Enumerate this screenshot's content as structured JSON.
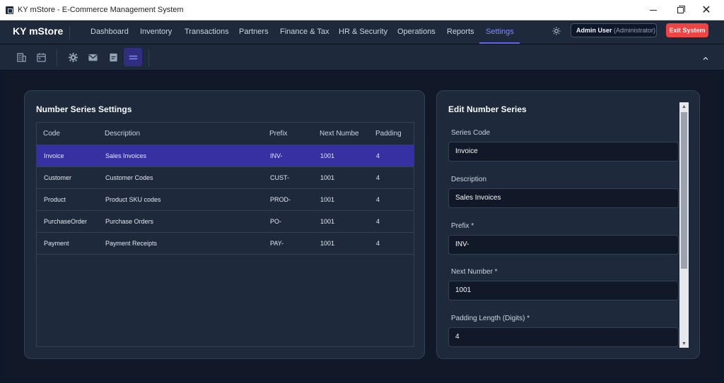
{
  "window": {
    "title": "KY mStore - E-Commerce Management System",
    "minimize_glyph": "",
    "maximize_glyph": "",
    "close_glyph": "✕"
  },
  "appbar": {
    "brand": "KY mStore",
    "nav": [
      {
        "label": "Dashboard"
      },
      {
        "label": "Inventory"
      },
      {
        "label": "Transactions"
      },
      {
        "label": "Partners"
      },
      {
        "label": "Finance & Tax"
      },
      {
        "label": "HR & Security"
      },
      {
        "label": "Operations"
      },
      {
        "label": "Reports"
      },
      {
        "label": "Settings",
        "active": true
      }
    ],
    "user_name": "Admin User",
    "user_role": "(Administrator)",
    "exit_label": "Exit System",
    "accent_color": "#6366f1",
    "exit_color": "#ef4444"
  },
  "toolbar": {
    "icons": [
      "building-icon",
      "calendar-icon",
      "gear-icon",
      "mail-icon",
      "document-icon",
      "number-series-icon"
    ],
    "active_icon": "number-series-icon"
  },
  "list_panel": {
    "title": "Number Series Settings",
    "columns": [
      "Code",
      "Description",
      "Prefix",
      "Next Numbe",
      "Padding"
    ],
    "rows": [
      {
        "code": "Invoice",
        "description": "Sales Invoices",
        "prefix": "INV-",
        "next": "1001",
        "padding": "4",
        "selected": true
      },
      {
        "code": "Customer",
        "description": "Customer Codes",
        "prefix": "CUST-",
        "next": "1001",
        "padding": "4"
      },
      {
        "code": "Product",
        "description": "Product SKU codes",
        "prefix": "PROD-",
        "next": "1001",
        "padding": "4"
      },
      {
        "code": "PurchaseOrder",
        "description": "Purchase Orders",
        "prefix": "PO-",
        "next": "1001",
        "padding": "4"
      },
      {
        "code": "Payment",
        "description": "Payment Receipts",
        "prefix": "PAY-",
        "next": "1001",
        "padding": "4"
      }
    ]
  },
  "edit_panel": {
    "title": "Edit Number Series",
    "fields": [
      {
        "label": "Series Code",
        "value": "Invoice"
      },
      {
        "label": "Description",
        "value": "Sales Invoices"
      },
      {
        "label": "Prefix *",
        "value": "INV-"
      },
      {
        "label": "Next Number *",
        "value": "1001"
      },
      {
        "label": "Padding Length (Digits) *",
        "value": "4"
      }
    ]
  }
}
